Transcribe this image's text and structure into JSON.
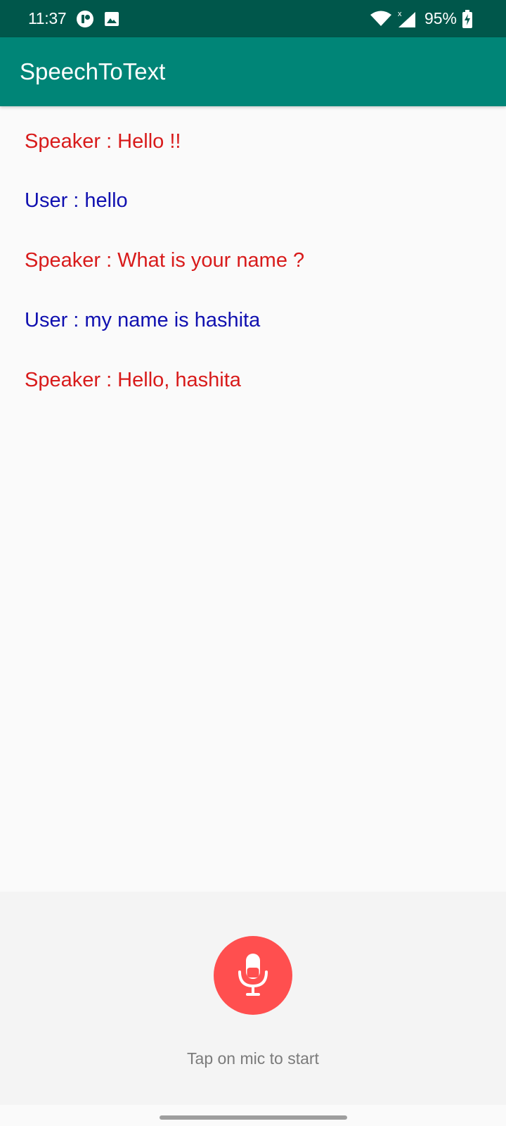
{
  "status_bar": {
    "time": "11:37",
    "battery": "95%",
    "icons": [
      "notification-icon",
      "image-icon",
      "wifi-icon",
      "signal-icon",
      "battery-charging-icon"
    ]
  },
  "app_bar": {
    "title": "SpeechToText",
    "color": "#008577"
  },
  "conversation": [
    {
      "role": "speaker",
      "text": "Speaker : Hello !!"
    },
    {
      "role": "user",
      "text": "User : hello"
    },
    {
      "role": "speaker",
      "text": "Speaker : What is your name ?"
    },
    {
      "role": "user",
      "text": "User : my name is hashita"
    },
    {
      "role": "speaker",
      "text": "Speaker : Hello, hashita"
    }
  ],
  "colors": {
    "speaker": "#d81b1b",
    "user": "#1010b0",
    "mic_button": "#ff4f4f"
  },
  "mic": {
    "icon": "microphone-icon",
    "hint": "Tap on mic to start"
  }
}
